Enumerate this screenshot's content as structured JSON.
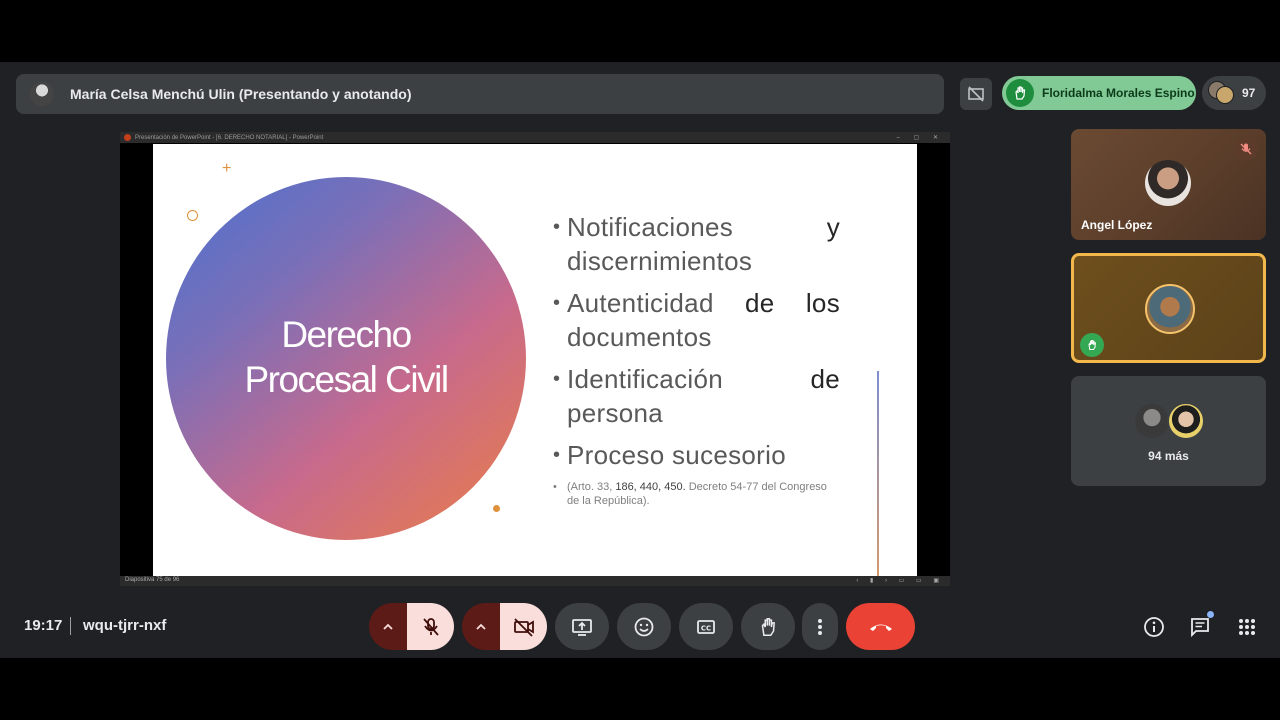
{
  "window": {
    "presenter_label": "María Celsa Menchú Ulin (Presentando y anotando)",
    "raised_hand_name": "Floridalma Morales Espino",
    "participant_count": "97"
  },
  "presentation": {
    "app_title": "Presentación de PowerPoint - [6. DERECHO NOTARIAL] - PowerPoint",
    "status_text": "Diapositiva 75 de 96",
    "slide": {
      "circle_title_line1": "Derecho",
      "circle_title_line2": "Procesal Civil",
      "bullets": [
        {
          "line1_a": "Notificaciones",
          "line1_b": "y",
          "line2": "discernimientos"
        },
        {
          "line1_a": "Autenticidad",
          "line1_mid": "de",
          "line1_b": "los",
          "line2": "documentos"
        },
        {
          "line1_a": "Identificación",
          "line1_b": "de",
          "line2": "persona"
        },
        {
          "line1_a": "Proceso sucesorio"
        }
      ],
      "note_prefix": "(Arto.",
      "note_nums": "33,",
      "note_bold": "186, 440, 450.",
      "note_rest": "Decreto 54-77 del Congreso de la República)."
    }
  },
  "tiles": {
    "angel_name": "Angel López",
    "more_label": "94 más"
  },
  "bottom": {
    "time": "19:17",
    "meeting_code": "wqu-tjrr-nxf"
  },
  "colors": {
    "background": "#202124",
    "hangup": "#ea4335",
    "raised_hand_chip": "#81c995",
    "active_speaker_border": "#f2b84b"
  }
}
